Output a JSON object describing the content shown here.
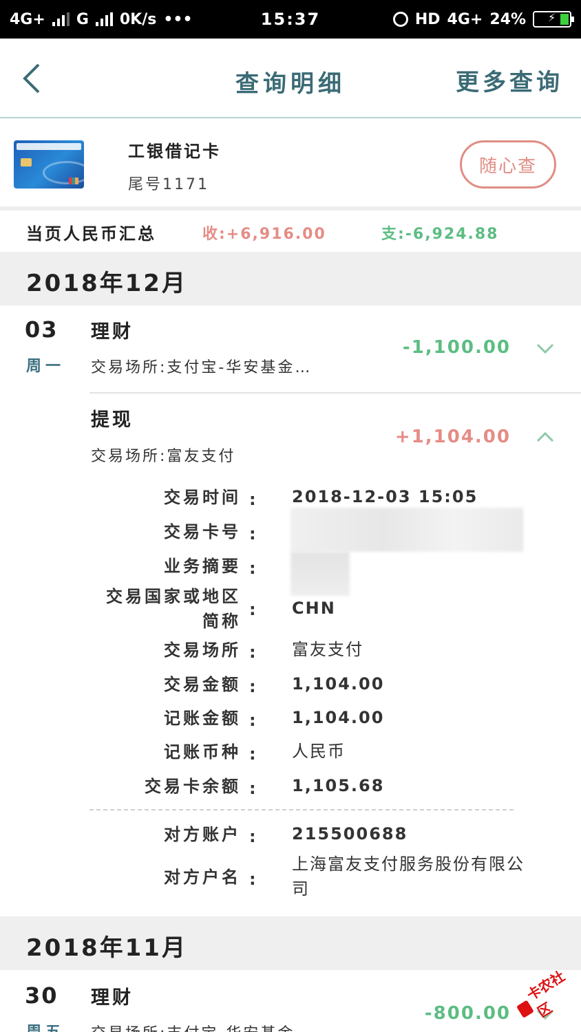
{
  "status_bar": {
    "network1": "4G+",
    "network2": "G",
    "speed": "0K/s",
    "dots": "•••",
    "time": "15:37",
    "hd": "HD",
    "network3": "4G+",
    "battery": "24%"
  },
  "nav": {
    "title": "查询明细",
    "more_label": "更多查询"
  },
  "card": {
    "name": "工银借记卡",
    "tail": "尾号1171",
    "query_button": "随心查"
  },
  "summary": {
    "label": "当页人民币汇总",
    "income": "收:+6,916.00",
    "expense": "支:-6,924.88"
  },
  "months": [
    {
      "label": "2018年12月",
      "transactions": [
        {
          "day": "03",
          "weekday": "周一",
          "type": "理财",
          "place": "交易场所:支付宝-华安基金…",
          "amount": "-1,100.00"
        },
        {
          "type": "提现",
          "place": "交易场所:富友支付",
          "amount": "+1,104.00",
          "details": {
            "time_label": "交易时间",
            "time_value": "2018-12-03 15:05",
            "card_label": "交易卡号",
            "summary_label": "业务摘要",
            "region_label_1": "交易国家或地区",
            "region_label_2": "简称",
            "region_value": "CHN",
            "place_label": "交易场所",
            "place_value": "富友支付",
            "amount_label": "交易金额",
            "amount_value": "1,104.00",
            "posted_label": "记账金额",
            "posted_value": "1,104.00",
            "currency_label": "记账币种",
            "currency_value": "人民币",
            "balance_label": "交易卡余额",
            "balance_value": "1,105.68",
            "counter_account_label": "对方账户",
            "counter_account_value": "215500688",
            "counter_name_label": "对方户名",
            "counter_name_value_1": "上海富友支付服务股份有限公",
            "counter_name_value_2": "司"
          }
        }
      ]
    },
    {
      "label": "2018年11月",
      "transactions": [
        {
          "day": "30",
          "weekday": "周五",
          "type": "理财",
          "place": "交易场所:支付宝-华安基金…",
          "amount": "-800.00"
        }
      ]
    }
  ],
  "colon": ":",
  "watermark": "卡农社区",
  "colors": {
    "title_teal": "#3b6b75",
    "income_red": "#e58c86",
    "expense_green": "#5cbd82",
    "query_button_border": "#e08d84",
    "month_bg": "#efefef"
  }
}
